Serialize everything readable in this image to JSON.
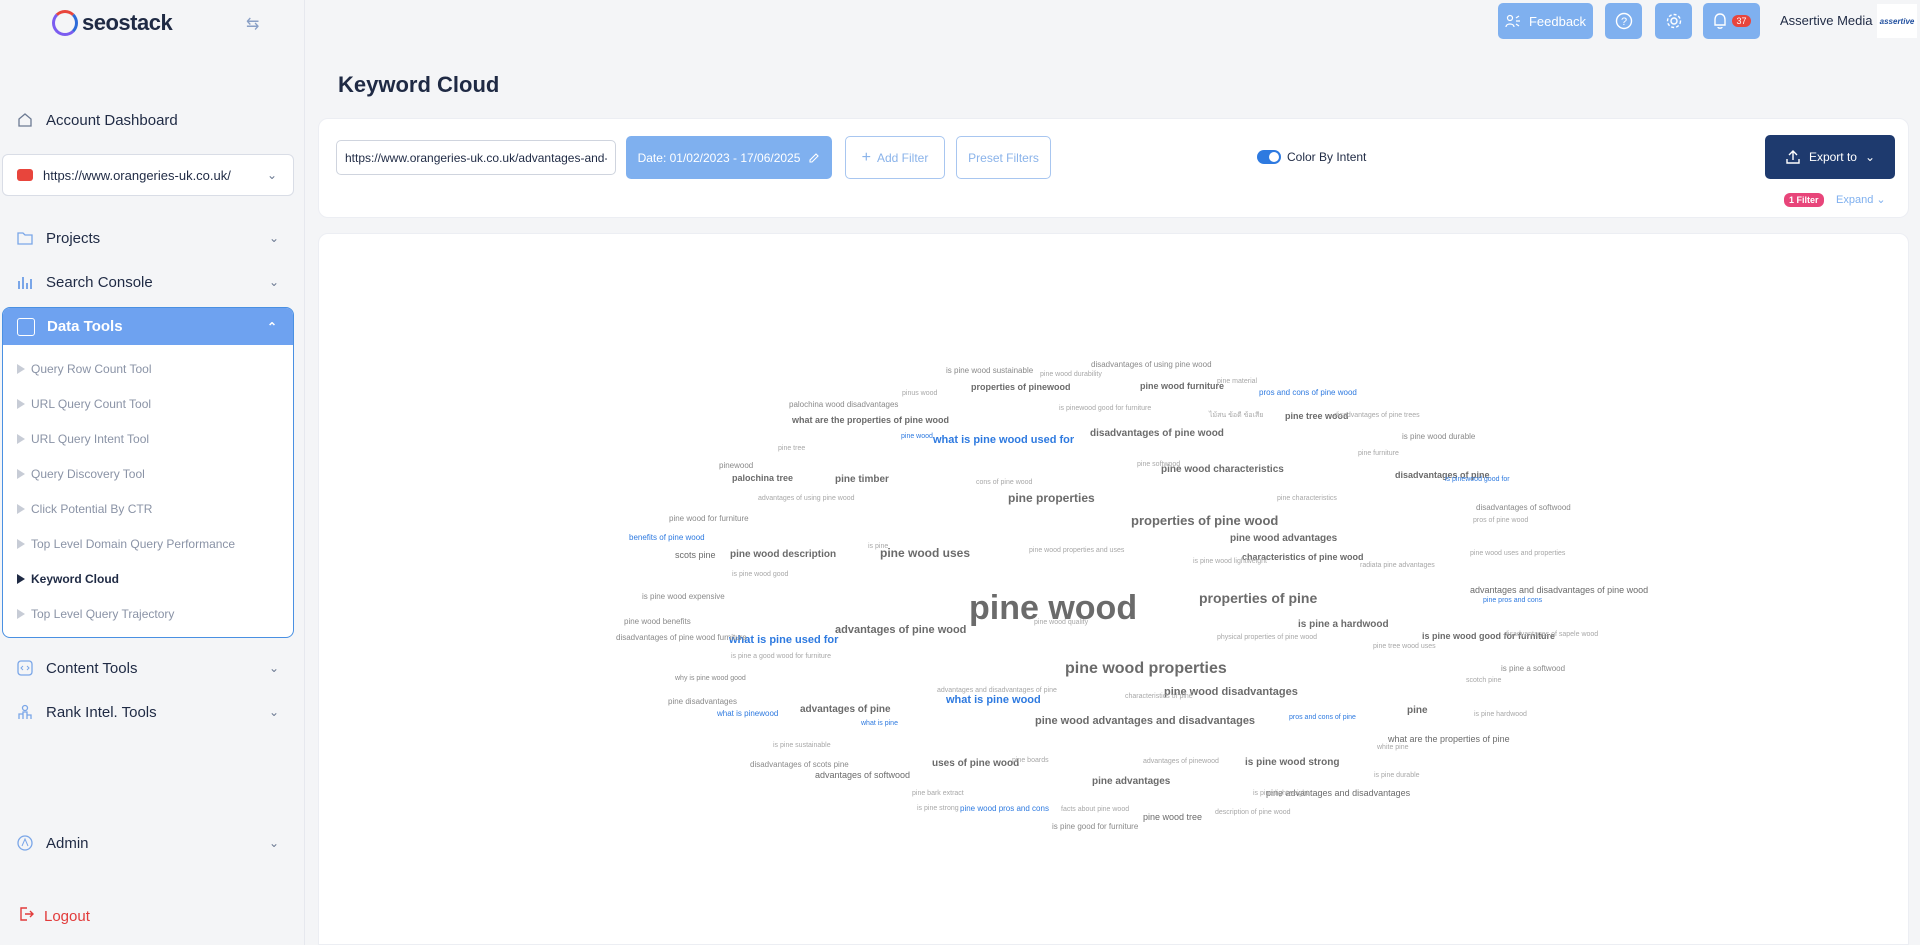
{
  "brand": {
    "name": "seostack"
  },
  "sidebar": {
    "account_dashboard": "Account Dashboard",
    "domain": "https://www.orangeries-uk.co.uk/",
    "projects": "Projects",
    "search_console": "Search Console",
    "data_tools": "Data Tools",
    "data_tool_items": [
      "Query Row Count Tool",
      "URL Query Count Tool",
      "URL Query Intent Tool",
      "Query Discovery Tool",
      "Click Potential By CTR",
      "Top Level Domain Query Performance",
      "Keyword Cloud",
      "Top Level Query Trajectory"
    ],
    "active_item": "Keyword Cloud",
    "content_tools": "Content Tools",
    "rank_intel_tools": "Rank Intel. Tools",
    "admin": "Admin",
    "logout": "Logout"
  },
  "topbar": {
    "feedback": "Feedback",
    "notifications_count": "37",
    "user_name": "Assertive Media",
    "user_logo_text": "assertive"
  },
  "page": {
    "title": "Keyword Cloud"
  },
  "filters": {
    "url_value": "https://www.orangeries-uk.co.uk/advantages-and-disadvantages-of-pine-wood/",
    "date_range": "Date: 01/02/2023 - 17/06/2025",
    "add_filter": "Add Filter",
    "preset_filters": "Preset Filters",
    "color_by_intent": "Color By Intent",
    "export": "Export to",
    "filter_count": "1 Filter",
    "expand": "Expand"
  },
  "colors": {
    "accent": "#7fb0ef",
    "navy": "#1e3a6e",
    "informational": "#2e7ae0",
    "neutral": "#6b6b6b"
  },
  "cloud_words": [
    {
      "text": "pine wood",
      "size": 34,
      "bold": true,
      "color": "#6b6b6b"
    },
    {
      "text": "pine wood properties",
      "size": 16,
      "bold": true,
      "color": "#6b6b6b"
    },
    {
      "text": "properties of pine wood",
      "size": 13,
      "bold": true,
      "color": "#6b6b6b"
    },
    {
      "text": "properties of pine",
      "size": 14,
      "bold": true,
      "color": "#6b6b6b"
    },
    {
      "text": "pine wood uses",
      "size": 12,
      "bold": true,
      "color": "#6b6b6b"
    },
    {
      "text": "advantages of pine wood",
      "size": 11,
      "bold": true,
      "color": "#6b6b6b"
    },
    {
      "text": "pine properties",
      "size": 12,
      "bold": true,
      "color": "#6b6b6b"
    },
    {
      "text": "what is pine wood used for",
      "size": 11,
      "bold": true,
      "color": "#2e7ae0"
    },
    {
      "text": "what is pine used for",
      "size": 11,
      "bold": true,
      "color": "#2e7ae0"
    },
    {
      "text": "what is pine wood",
      "size": 11,
      "bold": true,
      "color": "#2e7ae0"
    },
    {
      "text": "pine wood advantages and disadvantages",
      "size": 11,
      "bold": true,
      "color": "#6b6b6b"
    },
    {
      "text": "pine wood disadvantages",
      "size": 11,
      "bold": true,
      "color": "#6b6b6b"
    },
    {
      "text": "disadvantages of pine wood",
      "size": 10,
      "bold": true,
      "color": "#6b6b6b"
    },
    {
      "text": "pine wood characteristics",
      "size": 10,
      "bold": true,
      "color": "#6b6b6b"
    },
    {
      "text": "pine wood advantages",
      "size": 10,
      "bold": true,
      "color": "#6b6b6b"
    },
    {
      "text": "characteristics of pine wood",
      "size": 9,
      "bold": true,
      "color": "#6b6b6b"
    },
    {
      "text": "is pine a hardwood",
      "size": 10,
      "bold": true,
      "color": "#6b6b6b"
    },
    {
      "text": "is pine wood good for furniture",
      "size": 9,
      "bold": true,
      "color": "#6b6b6b"
    },
    {
      "text": "pine wood description",
      "size": 10,
      "bold": true,
      "color": "#6b6b6b"
    },
    {
      "text": "advantages of pine",
      "size": 10,
      "bold": true,
      "color": "#6b6b6b"
    },
    {
      "text": "uses of pine wood",
      "size": 10,
      "bold": true,
      "color": "#6b6b6b"
    },
    {
      "text": "pine advantages",
      "size": 10,
      "bold": true,
      "color": "#6b6b6b"
    },
    {
      "text": "is pine wood strong",
      "size": 10,
      "bold": true,
      "color": "#6b6b6b"
    },
    {
      "text": "pine timber",
      "size": 10,
      "bold": true,
      "color": "#6b6b6b"
    },
    {
      "text": "pine",
      "size": 10,
      "bold": true,
      "color": "#6b6b6b"
    },
    {
      "text": "disadvantages of pine",
      "size": 9,
      "bold": true,
      "color": "#6b6b6b"
    },
    {
      "text": "pine tree wood",
      "size": 9,
      "bold": true,
      "color": "#6b6b6b"
    },
    {
      "text": "pine wood furniture",
      "size": 9,
      "bold": true,
      "color": "#6b6b6b"
    },
    {
      "text": "properties of pinewood",
      "size": 9,
      "bold": true,
      "color": "#6b6b6b"
    },
    {
      "text": "palochina tree",
      "size": 9,
      "bold": true,
      "color": "#6b6b6b"
    },
    {
      "text": "what are the properties of pine wood",
      "size": 9,
      "bold": true,
      "color": "#6b6b6b"
    },
    {
      "text": "advantages and disadvantages of pine wood",
      "size": 9,
      "bold": false,
      "color": "#6b6b6b"
    },
    {
      "text": "pine advantages and disadvantages",
      "size": 9,
      "bold": false,
      "color": "#6b6b6b"
    },
    {
      "text": "what are the properties of pine",
      "size": 9,
      "bold": false,
      "color": "#6b6b6b"
    },
    {
      "text": "advantages of softwood",
      "size": 9,
      "bold": false,
      "color": "#6b6b6b"
    },
    {
      "text": "pine wood tree",
      "size": 9,
      "bold": false,
      "color": "#6b6b6b"
    },
    {
      "text": "scots pine",
      "size": 9,
      "bold": false,
      "color": "#6b6b6b"
    },
    {
      "text": "disadvantages of using pine wood",
      "size": 8,
      "bold": false,
      "color": "#8a8a8a"
    },
    {
      "text": "is pine wood sustainable",
      "size": 8,
      "bold": false,
      "color": "#8a8a8a"
    },
    {
      "text": "pine wood durability",
      "size": 7,
      "bold": false,
      "color": "#a8a8a8"
    },
    {
      "text": "pine material",
      "size": 7,
      "bold": false,
      "color": "#a8a8a8"
    },
    {
      "text": "pros and cons of pine wood",
      "size": 8,
      "bold": false,
      "color": "#2e7ae0"
    },
    {
      "text": "pinus wood",
      "size": 7,
      "bold": false,
      "color": "#a8a8a8"
    },
    {
      "text": "palochina wood disadvantages",
      "size": 8,
      "bold": false,
      "color": "#8a8a8a"
    },
    {
      "text": "is pinewood good for furniture",
      "size": 7,
      "bold": false,
      "color": "#a8a8a8"
    },
    {
      "text": "ไม้สน ข้อดี ข้อเสีย",
      "size": 7,
      "bold": false,
      "color": "#a8a8a8"
    },
    {
      "text": "disadvantages of pine trees",
      "size": 7,
      "bold": false,
      "color": "#a8a8a8"
    },
    {
      "text": "pine wood",
      "size": 7,
      "bold": false,
      "color": "#2e7ae0"
    },
    {
      "text": "is pine wood durable",
      "size": 8,
      "bold": false,
      "color": "#8a8a8a"
    },
    {
      "text": "pine tree",
      "size": 7,
      "bold": false,
      "color": "#a8a8a8"
    },
    {
      "text": "pine furniture",
      "size": 7,
      "bold": false,
      "color": "#a8a8a8"
    },
    {
      "text": "pinewood",
      "size": 8,
      "bold": false,
      "color": "#8a8a8a"
    },
    {
      "text": "pine softwood",
      "size": 7,
      "bold": false,
      "color": "#a8a8a8"
    },
    {
      "text": "cons of pine wood",
      "size": 7,
      "bold": false,
      "color": "#a8a8a8"
    },
    {
      "text": "is pinewood good for",
      "size": 7,
      "bold": false,
      "color": "#2e7ae0"
    },
    {
      "text": "advantages of using pine wood",
      "size": 7,
      "bold": false,
      "color": "#a8a8a8"
    },
    {
      "text": "pine characteristics",
      "size": 7,
      "bold": false,
      "color": "#a8a8a8"
    },
    {
      "text": "disadvantages of softwood",
      "size": 8,
      "bold": false,
      "color": "#8a8a8a"
    },
    {
      "text": "pine wood for furniture",
      "size": 8,
      "bold": false,
      "color": "#8a8a8a"
    },
    {
      "text": "pros of pine wood",
      "size": 7,
      "bold": false,
      "color": "#a8a8a8"
    },
    {
      "text": "benefits of pine wood",
      "size": 8,
      "bold": false,
      "color": "#2e7ae0"
    },
    {
      "text": "is pine",
      "size": 7,
      "bold": false,
      "color": "#a8a8a8"
    },
    {
      "text": "pine wood properties and uses",
      "size": 7,
      "bold": false,
      "color": "#a8a8a8"
    },
    {
      "text": "pine wood uses and properties",
      "size": 7,
      "bold": false,
      "color": "#a8a8a8"
    },
    {
      "text": "is pine wood lightweight",
      "size": 7,
      "bold": false,
      "color": "#a8a8a8"
    },
    {
      "text": "radiata pine advantages",
      "size": 7,
      "bold": false,
      "color": "#a8a8a8"
    },
    {
      "text": "is pine wood good",
      "size": 7,
      "bold": false,
      "color": "#a8a8a8"
    },
    {
      "text": "is pine wood expensive",
      "size": 8,
      "bold": false,
      "color": "#8a8a8a"
    },
    {
      "text": "pine pros and cons",
      "size": 7,
      "bold": false,
      "color": "#2e7ae0"
    },
    {
      "text": "pine wood benefits",
      "size": 8,
      "bold": false,
      "color": "#8a8a8a"
    },
    {
      "text": "pine wood quality",
      "size": 7,
      "bold": false,
      "color": "#a8a8a8"
    },
    {
      "text": "disadvantages of pine wood furniture",
      "size": 8,
      "bold": false,
      "color": "#8a8a8a"
    },
    {
      "text": "physical properties of pine wood",
      "size": 7,
      "bold": false,
      "color": "#a8a8a8"
    },
    {
      "text": "disadvantages of sapele wood",
      "size": 7,
      "bold": false,
      "color": "#a8a8a8"
    },
    {
      "text": "is pine a good wood for furniture",
      "size": 7,
      "bold": false,
      "color": "#a8a8a8"
    },
    {
      "text": "pine tree wood uses",
      "size": 7,
      "bold": false,
      "color": "#a8a8a8"
    },
    {
      "text": "is pine a softwood",
      "size": 8,
      "bold": false,
      "color": "#8a8a8a"
    },
    {
      "text": "why is pine wood good",
      "size": 7,
      "bold": false,
      "color": "#8a8a8a"
    },
    {
      "text": "scotch pine",
      "size": 7,
      "bold": false,
      "color": "#a8a8a8"
    },
    {
      "text": "advantages and disadvantages of pine",
      "size": 7,
      "bold": false,
      "color": "#a8a8a8"
    },
    {
      "text": "characteristics of pine",
      "size": 7,
      "bold": false,
      "color": "#a8a8a8"
    },
    {
      "text": "pine disadvantages",
      "size": 8,
      "bold": false,
      "color": "#8a8a8a"
    },
    {
      "text": "what is pinewood",
      "size": 8,
      "bold": false,
      "color": "#2e7ae0"
    },
    {
      "text": "pros and cons of pine",
      "size": 7,
      "bold": false,
      "color": "#2e7ae0"
    },
    {
      "text": "is pine hardwood",
      "size": 7,
      "bold": false,
      "color": "#a8a8a8"
    },
    {
      "text": "what is pine",
      "size": 7,
      "bold": false,
      "color": "#2e7ae0"
    },
    {
      "text": "white pine",
      "size": 7,
      "bold": false,
      "color": "#a8a8a8"
    },
    {
      "text": "is pine sustainable",
      "size": 7,
      "bold": false,
      "color": "#a8a8a8"
    },
    {
      "text": "pine boards",
      "size": 7,
      "bold": false,
      "color": "#a8a8a8"
    },
    {
      "text": "advantages of pinewood",
      "size": 7,
      "bold": false,
      "color": "#a8a8a8"
    },
    {
      "text": "disadvantages of scots pine",
      "size": 8,
      "bold": false,
      "color": "#8a8a8a"
    },
    {
      "text": "is pine durable",
      "size": 7,
      "bold": false,
      "color": "#a8a8a8"
    },
    {
      "text": "pine bark extract",
      "size": 7,
      "bold": false,
      "color": "#a8a8a8"
    },
    {
      "text": "is pine lightweight",
      "size": 7,
      "bold": false,
      "color": "#a8a8a8"
    },
    {
      "text": "is pine strong",
      "size": 7,
      "bold": false,
      "color": "#a8a8a8"
    },
    {
      "text": "pine wood pros and cons",
      "size": 8,
      "bold": false,
      "color": "#2e7ae0"
    },
    {
      "text": "facts about pine wood",
      "size": 7,
      "bold": false,
      "color": "#a8a8a8"
    },
    {
      "text": "description of pine wood",
      "size": 7,
      "bold": false,
      "color": "#a8a8a8"
    },
    {
      "text": "is pine good for furniture",
      "size": 8,
      "bold": false,
      "color": "#8a8a8a"
    }
  ]
}
